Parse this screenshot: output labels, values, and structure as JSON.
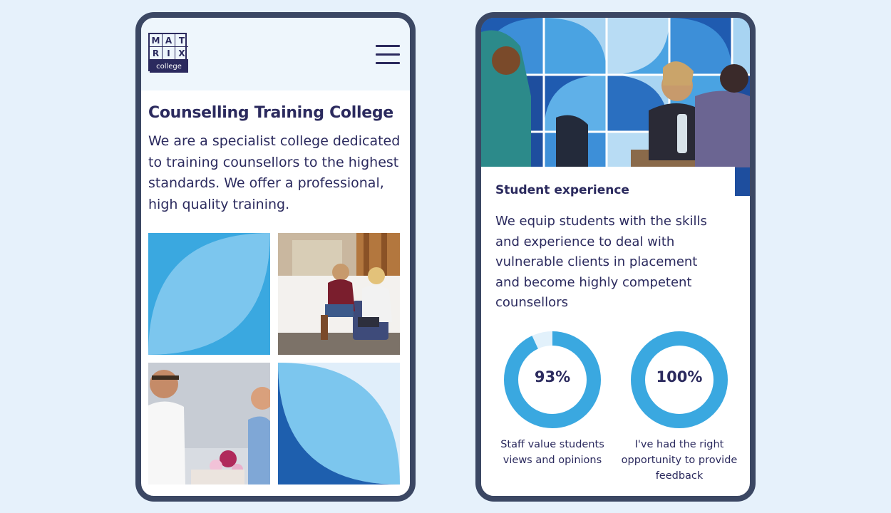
{
  "brand": {
    "logo_letters": [
      "M",
      "A",
      "T",
      "R",
      "I",
      "X"
    ],
    "logo_word": "college",
    "navy": "#2b2a5e",
    "blue": "#3aa8e0",
    "light_blue": "#e6f1fb"
  },
  "header": {
    "menu_icon": "hamburger-menu-icon"
  },
  "left": {
    "title": "Counselling Training College",
    "intro": "We are a specialist college dedicated to training counsellors to the highest standards. We offer a professional, high quality training.",
    "tiles": [
      "blue-leaf-pattern",
      "photo-two-women-talking",
      "photo-two-men-talking",
      "blue-leaf-pattern"
    ]
  },
  "right": {
    "hero": "photo-students-at-table",
    "title": "Student experience",
    "intro": "We equip students with the skills and experience to deal with vulnerable clients in placement and become highly competent counsellors",
    "stats": [
      {
        "value": "93%",
        "fraction": 0.93,
        "label": "Staff value students views and opinions"
      },
      {
        "value": "100%",
        "fraction": 1.0,
        "label": "I've had the right opportunity to provide feedback"
      }
    ]
  }
}
